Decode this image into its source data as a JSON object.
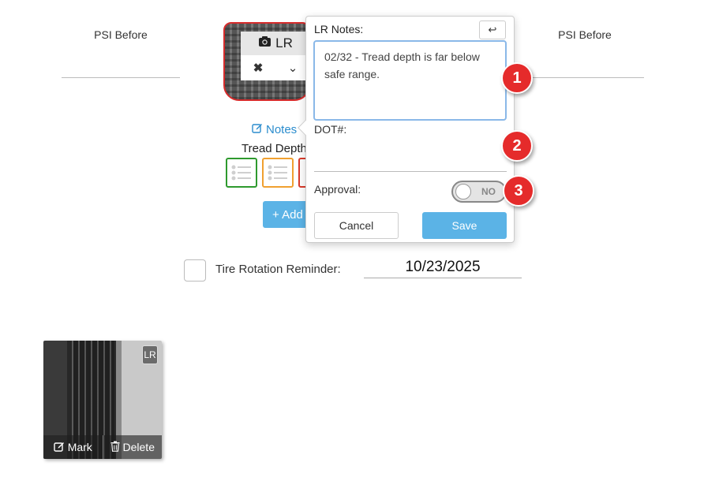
{
  "left_psi": {
    "label": "PSI Before"
  },
  "right_psi": {
    "label": "PSI Before"
  },
  "tire": {
    "position_label": "LR",
    "camera_icon": "camera-icon",
    "remove_icon": "x-icon",
    "expand_icon": "chevron-down-icon"
  },
  "notes_link": {
    "label": "Notes"
  },
  "tread": {
    "label": "Tread Depth",
    "buttons": [
      {
        "color": "#2e9a2e"
      },
      {
        "color": "#f0a030"
      },
      {
        "color": "#d83a2a"
      }
    ]
  },
  "add_button": {
    "label": "+ Add"
  },
  "reminder": {
    "label": "Tire Rotation Reminder:",
    "date": "10/23/2025",
    "checked": false
  },
  "popover": {
    "title": "LR Notes:",
    "undo_icon": "↩",
    "notes_value": "02/32 - Tread depth is far below safe range.",
    "dot_label": "DOT#:",
    "approval_label": "Approval:",
    "toggle_text": "NO",
    "cancel_label": "Cancel",
    "save_label": "Save"
  },
  "markers": [
    "1",
    "2",
    "3"
  ],
  "photo": {
    "badge": "LR",
    "mark_label": "Mark",
    "delete_label": "Delete"
  },
  "colors": {
    "accent": "#5bb3e6",
    "link": "#2a8ccd",
    "marker": "#e52b2b"
  }
}
